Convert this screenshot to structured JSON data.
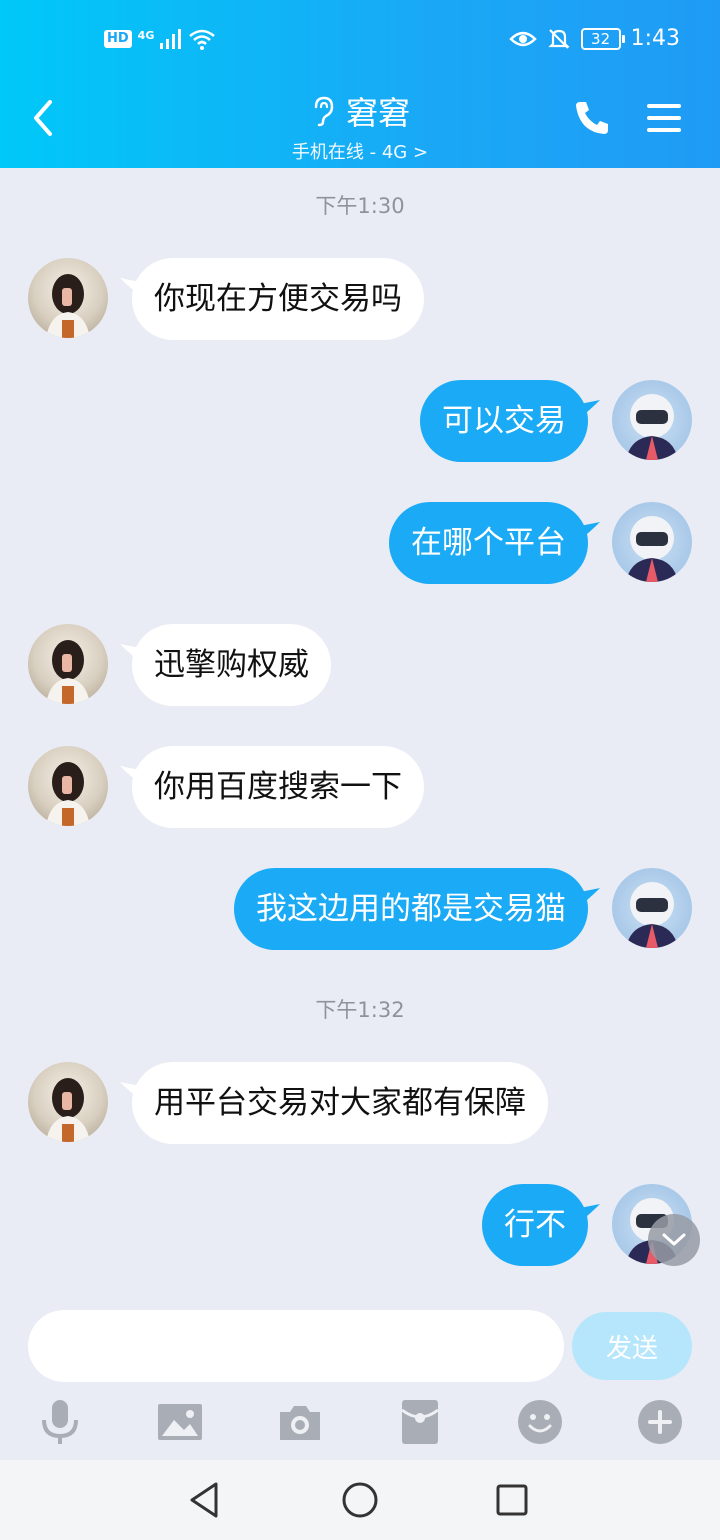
{
  "status_bar": {
    "hd_badge": "HD",
    "network": "4G",
    "battery_level": "32",
    "time": "1:43"
  },
  "header": {
    "title": "窘窘",
    "subtitle": "手机在线 - 4G >"
  },
  "chat": {
    "timestamps": [
      "下午1:30",
      "下午1:32"
    ],
    "messages": [
      {
        "side": "in",
        "text": "你现在方便交易吗"
      },
      {
        "side": "out",
        "text": "可以交易"
      },
      {
        "side": "out",
        "text": "在哪个平台"
      },
      {
        "side": "in",
        "text": "迅擎购权威"
      },
      {
        "side": "in",
        "text": "你用百度搜索一下"
      },
      {
        "side": "out",
        "text": "我这边用的都是交易猫"
      },
      {
        "side": "in",
        "text": "用平台交易对大家都有保障"
      },
      {
        "side": "out",
        "text": "行不"
      }
    ]
  },
  "composer": {
    "input_value": "",
    "send_label": "发送"
  },
  "colors": {
    "header_start": "#00c8f8",
    "header_end": "#1f9bf5",
    "outgoing_bubble": "#1aaaf6",
    "incoming_bubble": "#ffffff",
    "background": "#e9ecf4",
    "send_button_disabled": "#b5e6fb"
  },
  "icons": {
    "back": "chevron-left-icon",
    "ear": "ear-icon",
    "phone": "phone-icon",
    "menu": "menu-icon",
    "voice": "microphone-icon",
    "image": "image-icon",
    "camera": "camera-icon",
    "red_packet": "red-packet-icon",
    "emoji": "emoji-icon",
    "more": "plus-circle-icon"
  }
}
